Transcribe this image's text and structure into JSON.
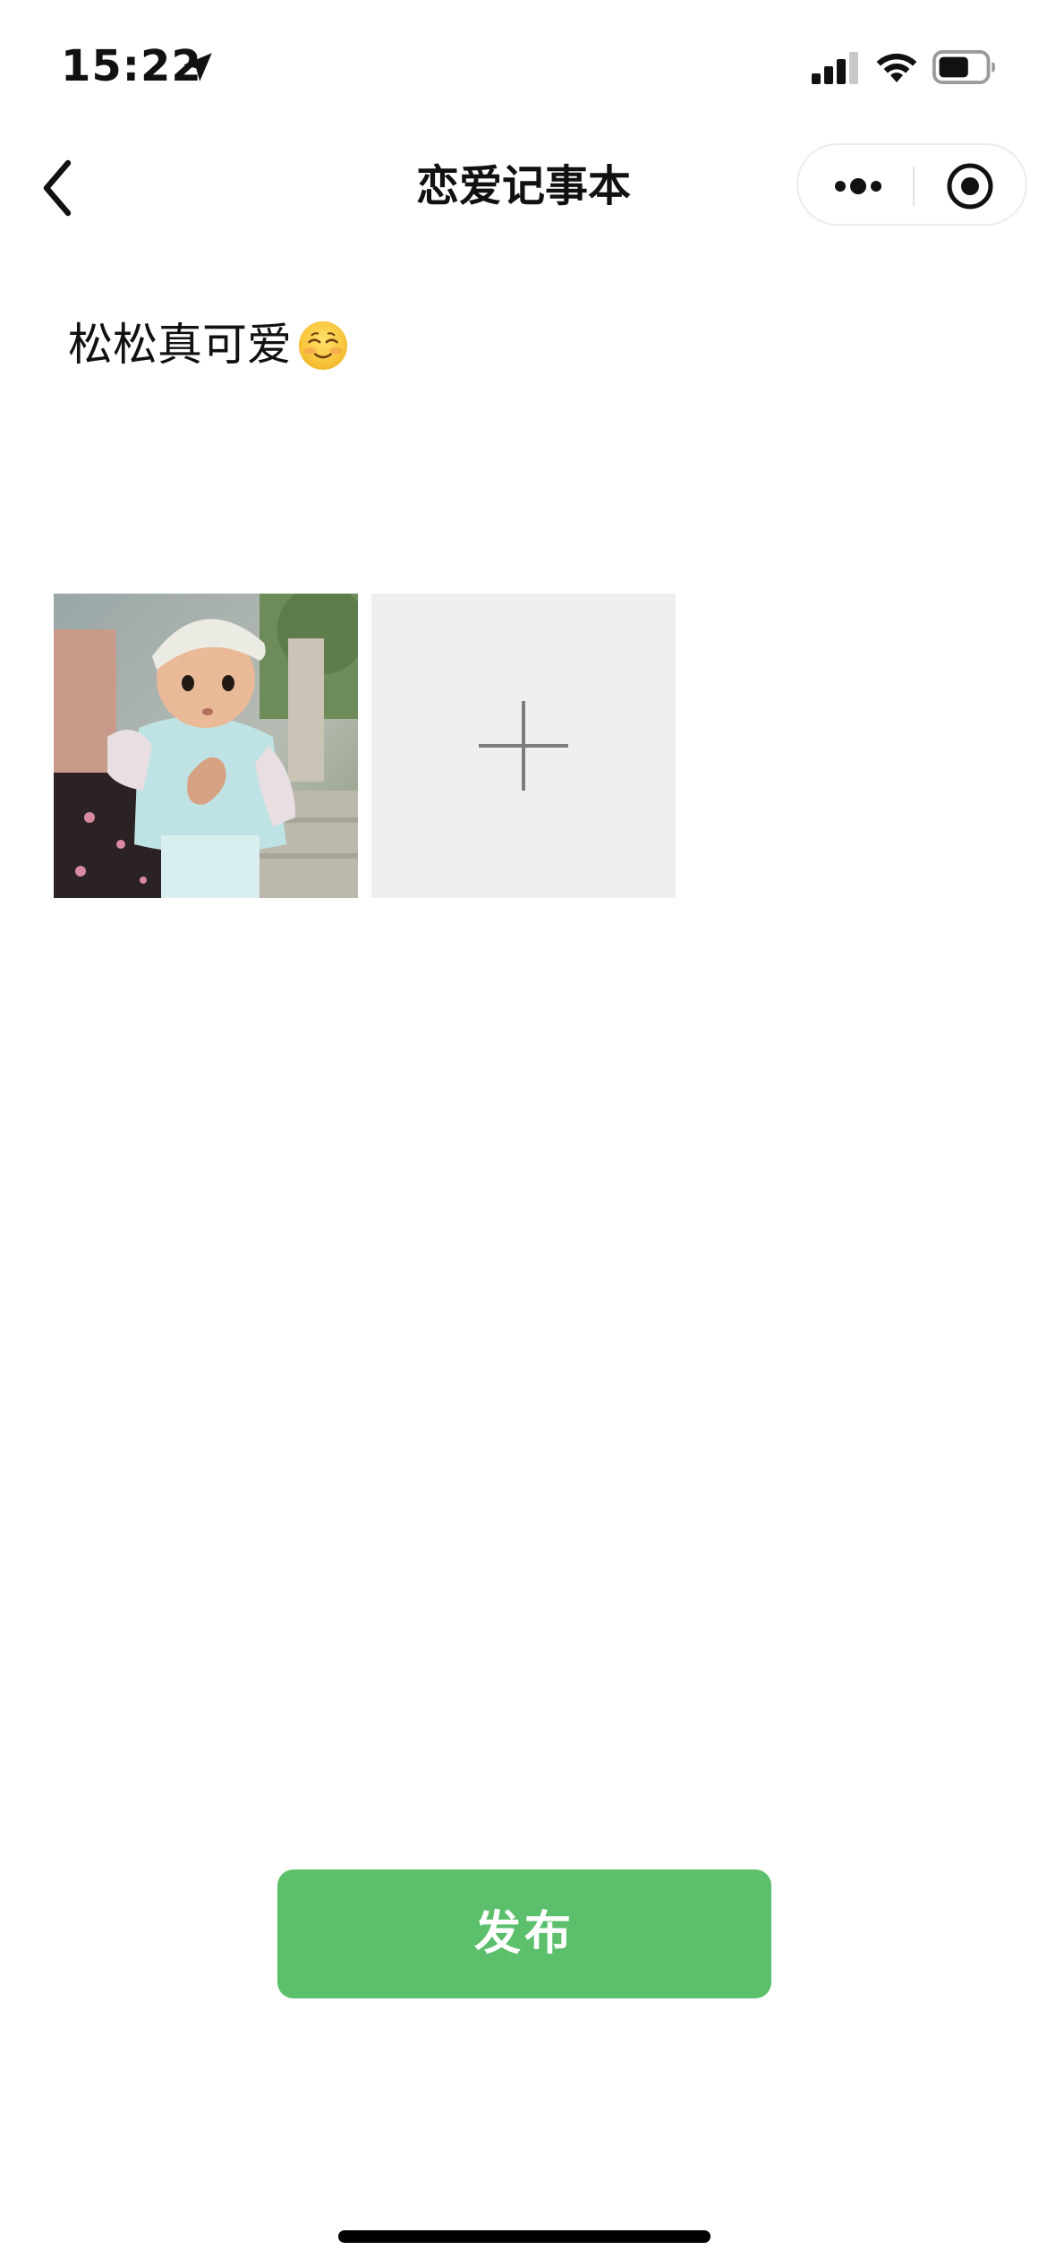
{
  "status_bar": {
    "time": "15:22",
    "icons": [
      "location-arrow-icon",
      "signal-icon",
      "wifi-icon",
      "battery-icon"
    ]
  },
  "nav": {
    "title": "恋爱记事本",
    "back_icon": "chevron-left-icon",
    "capsule_icons": [
      "more-icon",
      "target-icon"
    ]
  },
  "post": {
    "text": "松松真可爱",
    "emoji": "smiling-face-icon"
  },
  "photos": {
    "items": [
      {
        "icon": "photo-thumbnail"
      }
    ],
    "add_icon": "plus-icon"
  },
  "actions": {
    "publish_label": "发布"
  },
  "colors": {
    "accent_green": "#5bbf6b",
    "add_tile_bg": "#efefef"
  }
}
